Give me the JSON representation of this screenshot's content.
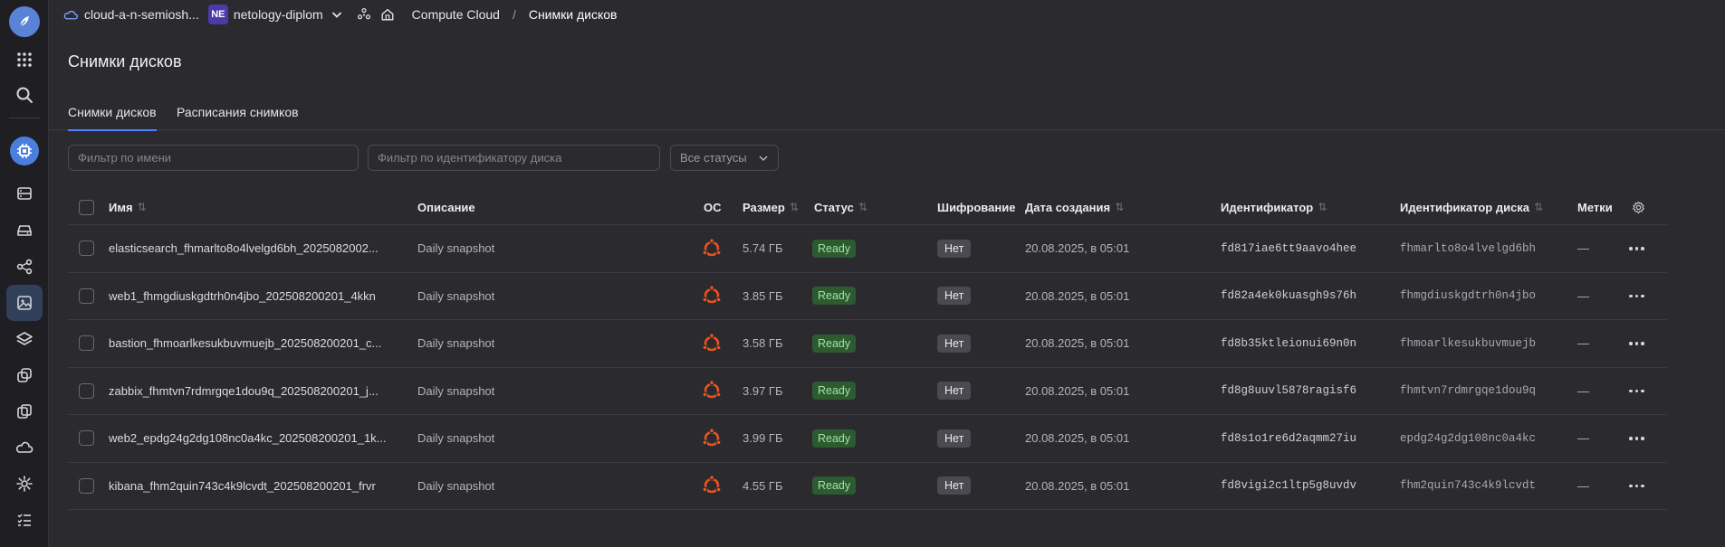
{
  "topbar": {
    "cloud_name": "cloud-a-n-semiosh...",
    "folder_badge": "NE",
    "folder_name": "netology-diplom",
    "breadcrumb_service": "Compute Cloud",
    "breadcrumb_separator": "/",
    "breadcrumb_current": "Снимки дисков"
  },
  "page": {
    "title": "Снимки дисков",
    "tabs": [
      {
        "label": "Снимки дисков",
        "active": true
      },
      {
        "label": "Расписания снимков",
        "active": false
      }
    ]
  },
  "filters": {
    "name_placeholder": "Фильтр по имени",
    "disk_id_placeholder": "Фильтр по идентификатору диска",
    "status_value": "Все статусы"
  },
  "table": {
    "columns": {
      "name": "Имя",
      "description": "Описание",
      "os": "ОС",
      "size": "Размер",
      "status": "Статус",
      "encryption": "Шифрование",
      "created": "Дата создания",
      "id": "Идентификатор",
      "disk_id": "Идентификатор диска",
      "labels": "Метки",
      "sort_glyph": "⇅"
    },
    "rows": [
      {
        "name": "elasticsearch_fhmarlto8o4lvelgd6bh_2025082002...",
        "description": "Daily snapshot",
        "size": "5.74 ГБ",
        "status": "Ready",
        "encryption": "Нет",
        "created": "20.08.2025, в 05:01",
        "id": "fd817iae6tt9aavo4hee",
        "disk_id": "fhmarlto8o4lvelgd6bh",
        "labels": "—"
      },
      {
        "name": "web1_fhmgdiuskgdtrh0n4jbo_202508200201_4kkn",
        "description": "Daily snapshot",
        "size": "3.85 ГБ",
        "status": "Ready",
        "encryption": "Нет",
        "created": "20.08.2025, в 05:01",
        "id": "fd82a4ek0kuasgh9s76h",
        "disk_id": "fhmgdiuskgdtrh0n4jbo",
        "labels": "—"
      },
      {
        "name": "bastion_fhmoarlkesukbuvmuejb_202508200201_c...",
        "description": "Daily snapshot",
        "size": "3.58 ГБ",
        "status": "Ready",
        "encryption": "Нет",
        "created": "20.08.2025, в 05:01",
        "id": "fd8b35ktleionui69n0n",
        "disk_id": "fhmoarlkesukbuvmuejb",
        "labels": "—"
      },
      {
        "name": "zabbix_fhmtvn7rdmrgqe1dou9q_202508200201_j...",
        "description": "Daily snapshot",
        "size": "3.97 ГБ",
        "status": "Ready",
        "encryption": "Нет",
        "created": "20.08.2025, в 05:01",
        "id": "fd8g8uuvl5878ragisf6",
        "disk_id": "fhmtvn7rdmrgqe1dou9q",
        "labels": "—"
      },
      {
        "name": "web2_epdg24g2dg108nc0a4kc_202508200201_1k...",
        "description": "Daily snapshot",
        "size": "3.99 ГБ",
        "status": "Ready",
        "encryption": "Нет",
        "created": "20.08.2025, в 05:01",
        "id": "fd8s1o1re6d2aqmm27iu",
        "disk_id": "epdg24g2dg108nc0a4kc",
        "labels": "—"
      },
      {
        "name": "kibana_fhm2quin743c4k9lcvdt_202508200201_frvr",
        "description": "Daily snapshot",
        "size": "4.55 ГБ",
        "status": "Ready",
        "encryption": "Нет",
        "created": "20.08.2025, в 05:01",
        "id": "fd8vigi2c1ltp5g8uvdv",
        "disk_id": "fhm2quin743c4k9lcvdt",
        "labels": "—"
      }
    ]
  },
  "colors": {
    "background": "#2a2a2f",
    "rail": "#1f1f23",
    "accent": "#4f83ff",
    "ready_bg": "#2d5a31",
    "ready_text": "#9fe2a4",
    "ubuntu": "#e95420"
  }
}
